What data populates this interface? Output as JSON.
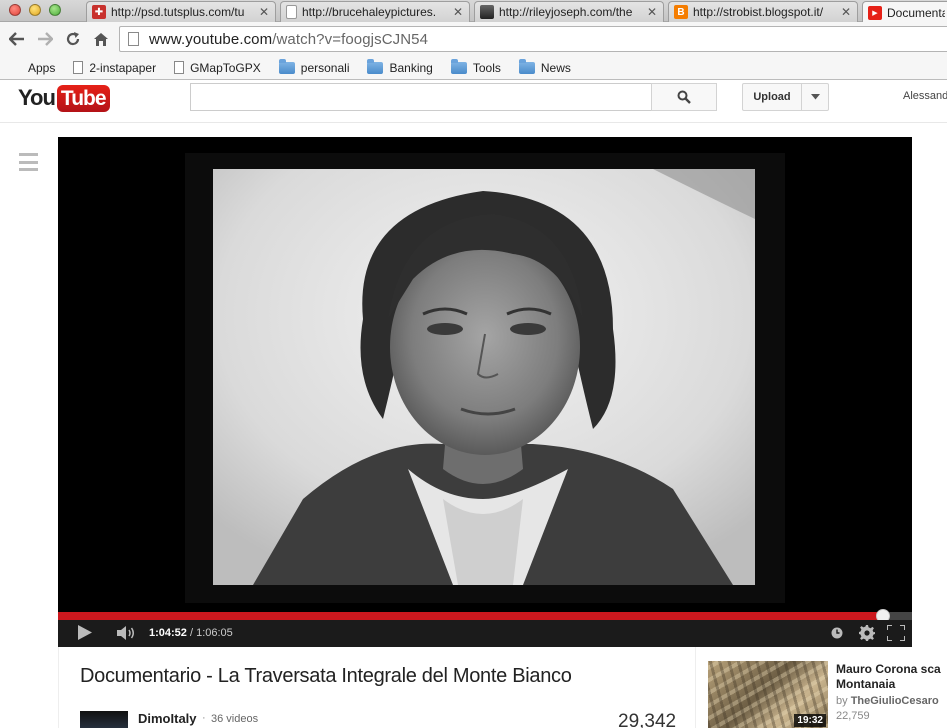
{
  "browser": {
    "tabs": [
      {
        "title": "http://psd.tutsplus.com/tu",
        "favicon": "tutsplus-cross-icon",
        "color": "#c8312d"
      },
      {
        "title": "http://brucehaleypictures.",
        "favicon": "page-icon",
        "color": "#ffffff"
      },
      {
        "title": "http://rileyjoseph.com/the",
        "favicon": "photo-favicon-icon",
        "color": "#3a3a3a"
      },
      {
        "title": "http://strobist.blogspot.it/",
        "favicon": "blogger-icon",
        "color": "#f57d00"
      },
      {
        "title": "Documenta",
        "favicon": "youtube-play-icon",
        "color": "#e62117"
      }
    ],
    "url": {
      "host": "www.youtube.com",
      "path": "/watch?v=foogjsCJN54"
    },
    "bookmarks": [
      {
        "label": "Apps",
        "icon": "apps-grid-icon"
      },
      {
        "label": "2-instapaper",
        "icon": "page-icon"
      },
      {
        "label": "GMapToGPX",
        "icon": "page-icon"
      },
      {
        "label": "personali",
        "icon": "folder-icon"
      },
      {
        "label": "Banking",
        "icon": "folder-icon"
      },
      {
        "label": "Tools",
        "icon": "folder-icon"
      },
      {
        "label": "News",
        "icon": "folder-icon"
      }
    ]
  },
  "youtube": {
    "logo": {
      "you": "You",
      "tube": "Tube"
    },
    "search": {
      "value": "",
      "placeholder": ""
    },
    "upload_label": "Upload",
    "user_name": "Alessand",
    "accent": "#cc181e"
  },
  "player": {
    "time_current": "1:04:52",
    "time_separator": " / ",
    "time_total": "1:06:05",
    "progress_fraction": 0.9656
  },
  "video": {
    "title": "Documentario - La Traversata Integrale del Monte Bianco",
    "channel_name": "DimoItaly",
    "channel_separator": "·",
    "channel_videos": "36 videos",
    "view_count": "29,342"
  },
  "related": [
    {
      "title_line1": "Mauro Corona sca",
      "title_line2": "Montanaia",
      "by_prefix": "by",
      "channel": "TheGiulioCesaro",
      "views": "22,759",
      "duration": "19:32"
    }
  ]
}
